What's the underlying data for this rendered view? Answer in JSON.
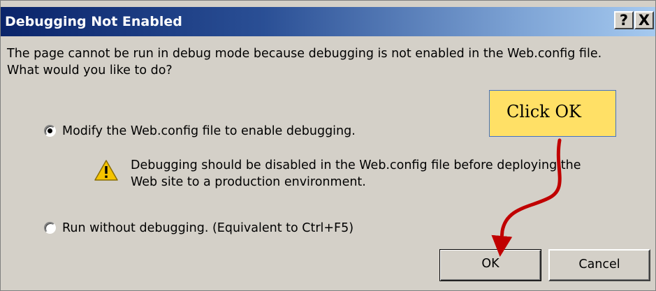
{
  "dialog": {
    "title": "Debugging Not Enabled",
    "help_glyph": "?",
    "close_glyph": "X",
    "message_line1": "The page cannot be run in debug mode because debugging is not enabled in the Web.config file.",
    "message_line2": "What would you like to do?"
  },
  "options": [
    {
      "label": "Modify the Web.config file to enable debugging.",
      "selected": true
    },
    {
      "label": "Run without debugging. (Equivalent to Ctrl+F5)",
      "selected": false
    }
  ],
  "warning": {
    "icon": "warning-triangle-icon",
    "line1": "Debugging should be disabled in the Web.config file before deploying the",
    "line2": "Web site to a production environment."
  },
  "buttons": {
    "ok": "OK",
    "cancel": "Cancel"
  },
  "annotation": {
    "callout_text": "Click OK",
    "arrow_color": "#c00000",
    "callout_color": "#ffe066"
  },
  "colors": {
    "titlebar_start": "#0a246a",
    "titlebar_end": "#a6caf0",
    "dialog_bg": "#d4d0c8"
  }
}
